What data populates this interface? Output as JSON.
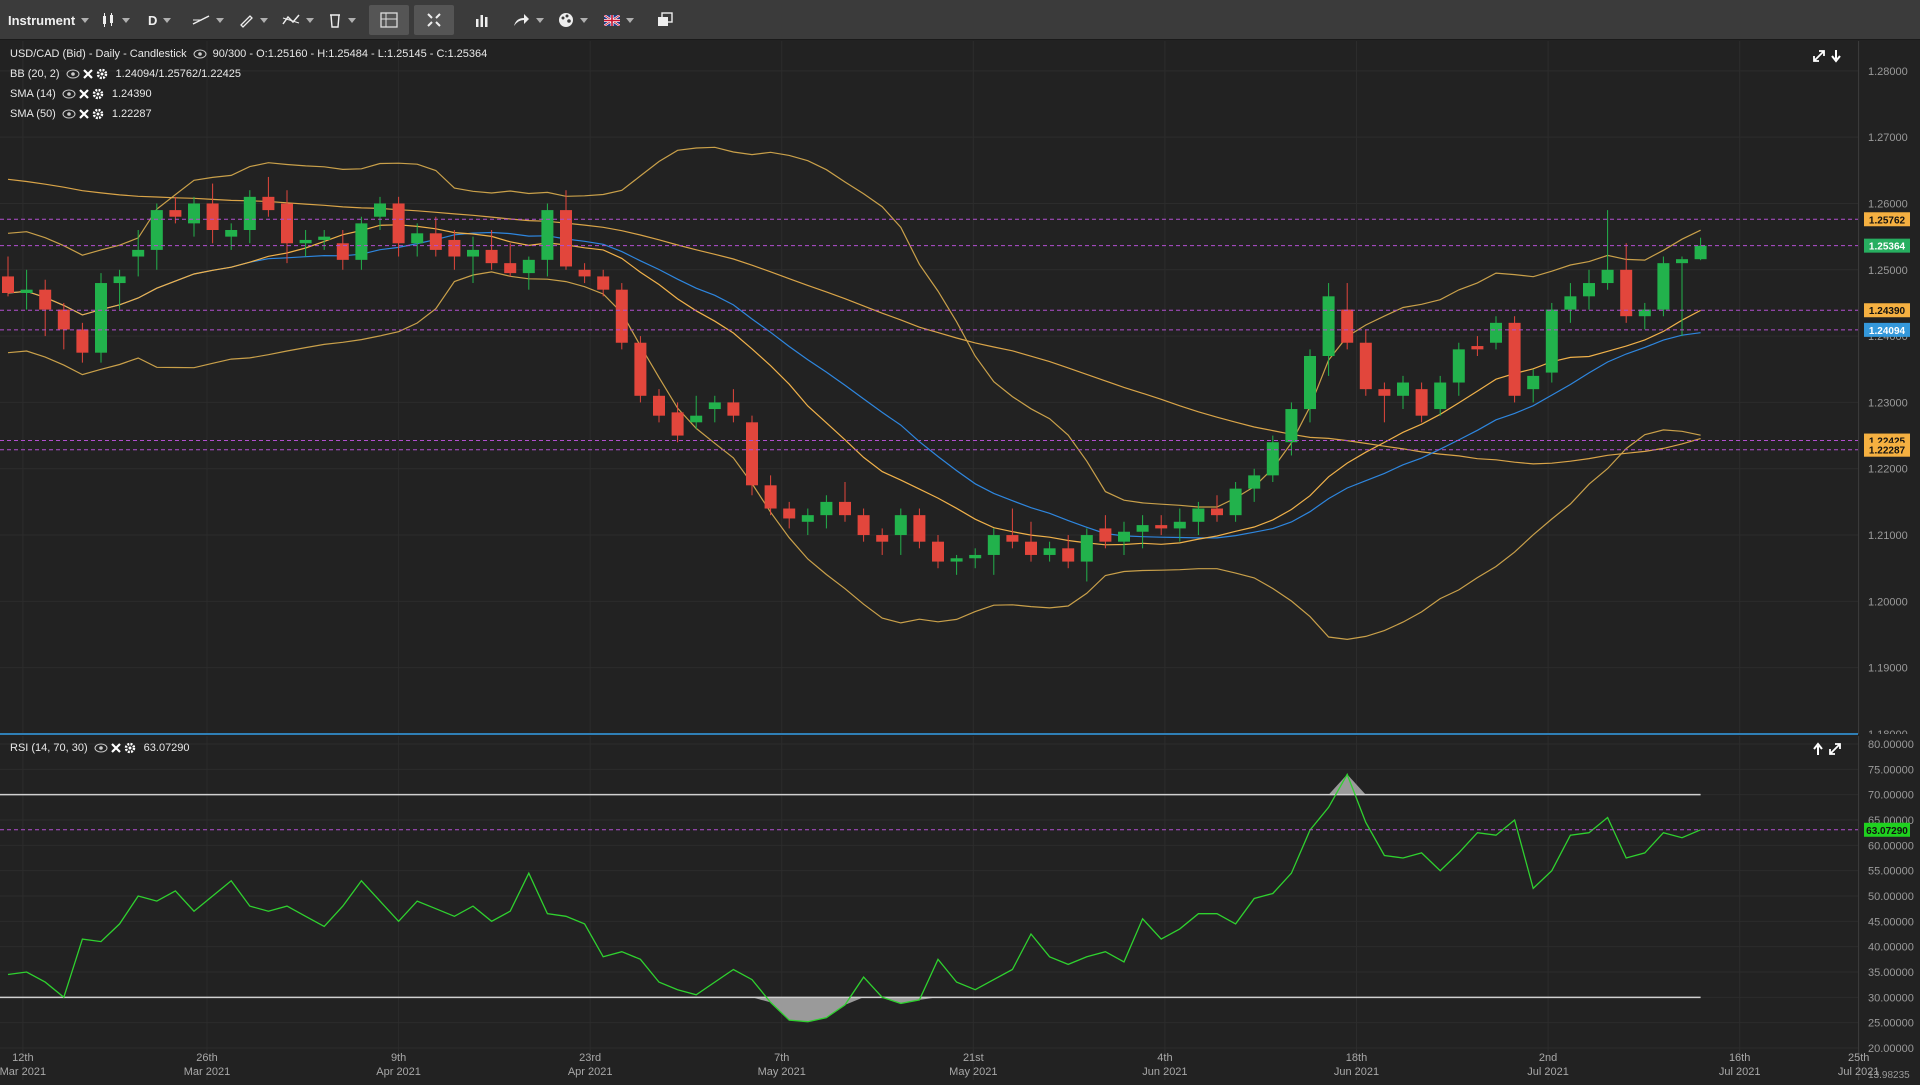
{
  "toolbar": {
    "instrument_label": "Instrument",
    "timeframe_label": "D"
  },
  "main_chart": {
    "header": "USD/CAD (Bid) - Daily - Candlestick",
    "ohlc": "90/300 - O:1.25160 - H:1.25484 - L:1.25145 - C:1.25364",
    "indicators": [
      {
        "name": "BB (20, 2)",
        "value": "1.24094/1.25762/1.22425"
      },
      {
        "name": "SMA (14)",
        "value": "1.24390"
      },
      {
        "name": "SMA (50)",
        "value": "1.22287"
      }
    ],
    "y_ticks": [
      "1.28000",
      "1.27000",
      "1.26000",
      "1.25000",
      "1.24000",
      "1.23000",
      "1.22000",
      "1.21000",
      "1.20000",
      "1.19000",
      "1.18000"
    ],
    "price_tags": [
      {
        "label": "1.25762",
        "value": 1.25762,
        "color": "#f5b041"
      },
      {
        "label": "1.25364",
        "value": 1.25364,
        "color": "#27ae60"
      },
      {
        "label": "1.24390",
        "value": 1.2439,
        "color": "#f5b041"
      },
      {
        "label": "1.24094",
        "value": 1.24094,
        "color": "#3498db"
      },
      {
        "label": "1.22425",
        "value": 1.22425,
        "color": "#f5b041"
      },
      {
        "label": "1.22287",
        "value": 1.22287,
        "color": "#f5b041"
      }
    ]
  },
  "rsi_chart": {
    "header": "RSI (14, 70, 30)",
    "value": "63.07290",
    "y_ticks": [
      "80.00000",
      "75.00000",
      "70.00000",
      "65.00000",
      "60.00000",
      "55.00000",
      "50.00000",
      "45.00000",
      "40.00000",
      "35.00000",
      "30.00000",
      "25.00000",
      "20.00000"
    ],
    "bottom_tick": "13.98235",
    "level_tag": {
      "label": "63.07290",
      "value": 63.0729,
      "color": "#1fd11f"
    }
  },
  "x_axis": [
    {
      "day": "12th",
      "month": "Mar 2021"
    },
    {
      "day": "26th",
      "month": "Mar 2021"
    },
    {
      "day": "9th",
      "month": "Apr 2021"
    },
    {
      "day": "23rd",
      "month": "Apr 2021"
    },
    {
      "day": "7th",
      "month": "May 2021"
    },
    {
      "day": "21st",
      "month": "May 2021"
    },
    {
      "day": "4th",
      "month": "Jun 2021"
    },
    {
      "day": "18th",
      "month": "Jun 2021"
    },
    {
      "day": "2nd",
      "month": "Jul 2021"
    },
    {
      "day": "16th",
      "month": "Jul 2021"
    },
    {
      "day": "25th",
      "month": "Jul 2021"
    }
  ],
  "chart_data": {
    "type": "candlestick",
    "instrument": "USD/CAD (Bid)",
    "timeframe": "Daily",
    "ylim": [
      1.18,
      1.2845
    ],
    "candles": [
      [
        1.249,
        1.252,
        1.246,
        1.2465
      ],
      [
        1.2465,
        1.25,
        1.244,
        1.247
      ],
      [
        1.247,
        1.2485,
        1.24,
        1.244
      ],
      [
        1.244,
        1.245,
        1.238,
        1.241
      ],
      [
        1.241,
        1.242,
        1.236,
        1.2375
      ],
      [
        1.2375,
        1.2495,
        1.236,
        1.248
      ],
      [
        1.248,
        1.25,
        1.244,
        1.249
      ],
      [
        1.252,
        1.256,
        1.249,
        1.253
      ],
      [
        1.253,
        1.26,
        1.25,
        1.259
      ],
      [
        1.259,
        1.261,
        1.257,
        1.258
      ],
      [
        1.257,
        1.261,
        1.255,
        1.26
      ],
      [
        1.26,
        1.263,
        1.254,
        1.256
      ],
      [
        1.255,
        1.257,
        1.253,
        1.256
      ],
      [
        1.256,
        1.262,
        1.254,
        1.261
      ],
      [
        1.261,
        1.264,
        1.258,
        1.259
      ],
      [
        1.26,
        1.262,
        1.251,
        1.254
      ],
      [
        1.254,
        1.256,
        1.252,
        1.2545
      ],
      [
        1.2545,
        1.256,
        1.253,
        1.255
      ],
      [
        1.254,
        1.256,
        1.25,
        1.2515
      ],
      [
        1.2515,
        1.258,
        1.25,
        1.257
      ],
      [
        1.258,
        1.261,
        1.256,
        1.26
      ],
      [
        1.26,
        1.261,
        1.252,
        1.254
      ],
      [
        1.254,
        1.257,
        1.252,
        1.2555
      ],
      [
        1.2555,
        1.258,
        1.252,
        1.253
      ],
      [
        1.2545,
        1.256,
        1.25,
        1.252
      ],
      [
        1.252,
        1.255,
        1.248,
        1.253
      ],
      [
        1.253,
        1.256,
        1.25,
        1.251
      ],
      [
        1.251,
        1.254,
        1.249,
        1.2495
      ],
      [
        1.2495,
        1.252,
        1.247,
        1.2515
      ],
      [
        1.2515,
        1.26,
        1.249,
        1.259
      ],
      [
        1.259,
        1.262,
        1.25,
        1.2505
      ],
      [
        1.25,
        1.251,
        1.248,
        1.249
      ],
      [
        1.249,
        1.25,
        1.246,
        1.247
      ],
      [
        1.247,
        1.248,
        1.238,
        1.239
      ],
      [
        1.239,
        1.24,
        1.23,
        1.231
      ],
      [
        1.231,
        1.232,
        1.227,
        1.228
      ],
      [
        1.2285,
        1.23,
        1.224,
        1.225
      ],
      [
        1.227,
        1.231,
        1.226,
        1.228
      ],
      [
        1.229,
        1.231,
        1.227,
        1.23
      ],
      [
        1.23,
        1.232,
        1.227,
        1.228
      ],
      [
        1.227,
        1.228,
        1.216,
        1.2175
      ],
      [
        1.2175,
        1.219,
        1.213,
        1.214
      ],
      [
        1.214,
        1.215,
        1.211,
        1.2125
      ],
      [
        1.212,
        1.214,
        1.21,
        1.213
      ],
      [
        1.213,
        1.216,
        1.211,
        1.215
      ],
      [
        1.215,
        1.218,
        1.212,
        1.213
      ],
      [
        1.213,
        1.214,
        1.209,
        1.21
      ],
      [
        1.21,
        1.211,
        1.207,
        1.209
      ],
      [
        1.21,
        1.214,
        1.207,
        1.213
      ],
      [
        1.213,
        1.214,
        1.208,
        1.209
      ],
      [
        1.209,
        1.21,
        1.205,
        1.206
      ],
      [
        1.206,
        1.207,
        1.204,
        1.2065
      ],
      [
        1.2065,
        1.208,
        1.205,
        1.207
      ],
      [
        1.207,
        1.211,
        1.204,
        1.21
      ],
      [
        1.21,
        1.214,
        1.208,
        1.209
      ],
      [
        1.209,
        1.212,
        1.206,
        1.207
      ],
      [
        1.207,
        1.209,
        1.206,
        1.208
      ],
      [
        1.208,
        1.21,
        1.205,
        1.206
      ],
      [
        1.206,
        1.211,
        1.203,
        1.21
      ],
      [
        1.211,
        1.213,
        1.208,
        1.209
      ],
      [
        1.209,
        1.212,
        1.207,
        1.2105
      ],
      [
        1.2105,
        1.213,
        1.208,
        1.2115
      ],
      [
        1.2115,
        1.213,
        1.21,
        1.211
      ],
      [
        1.211,
        1.214,
        1.209,
        1.212
      ],
      [
        1.212,
        1.215,
        1.21,
        1.214
      ],
      [
        1.214,
        1.216,
        1.212,
        1.213
      ],
      [
        1.213,
        1.218,
        1.212,
        1.217
      ],
      [
        1.217,
        1.22,
        1.215,
        1.219
      ],
      [
        1.219,
        1.225,
        1.218,
        1.224
      ],
      [
        1.224,
        1.23,
        1.222,
        1.229
      ],
      [
        1.229,
        1.238,
        1.227,
        1.237
      ],
      [
        1.237,
        1.248,
        1.234,
        1.246
      ],
      [
        1.244,
        1.248,
        1.238,
        1.239
      ],
      [
        1.239,
        1.241,
        1.231,
        1.232
      ],
      [
        1.232,
        1.233,
        1.227,
        1.231
      ],
      [
        1.231,
        1.234,
        1.229,
        1.233
      ],
      [
        1.232,
        1.233,
        1.227,
        1.228
      ],
      [
        1.229,
        1.234,
        1.228,
        1.233
      ],
      [
        1.233,
        1.239,
        1.231,
        1.238
      ],
      [
        1.2385,
        1.24,
        1.237,
        1.238
      ],
      [
        1.239,
        1.243,
        1.238,
        1.242
      ],
      [
        1.242,
        1.243,
        1.23,
        1.231
      ],
      [
        1.232,
        1.235,
        1.23,
        1.234
      ],
      [
        1.2345,
        1.245,
        1.233,
        1.244
      ],
      [
        1.244,
        1.248,
        1.242,
        1.246
      ],
      [
        1.246,
        1.25,
        1.244,
        1.248
      ],
      [
        1.248,
        1.259,
        1.247,
        1.25
      ],
      [
        1.25,
        1.254,
        1.242,
        1.243
      ],
      [
        1.243,
        1.245,
        1.241,
        1.244
      ],
      [
        1.244,
        1.252,
        1.243,
        1.251
      ],
      [
        1.251,
        1.252,
        1.24,
        1.2516
      ],
      [
        1.2516,
        1.25484,
        1.25145,
        1.25364
      ]
    ],
    "rsi": {
      "ylim": [
        20,
        80
      ],
      "overbought": 70,
      "oversold": 30,
      "values": [
        34.5,
        35,
        33,
        30,
        41.5,
        41,
        44.5,
        50,
        49,
        51,
        47,
        50,
        53,
        48,
        47,
        48,
        46,
        44,
        48,
        53,
        49,
        45,
        49,
        47.5,
        46,
        48,
        45,
        47,
        54.5,
        46.5,
        46,
        44.5,
        38,
        39,
        37.5,
        33,
        31.5,
        30.5,
        33,
        35.5,
        33.5,
        29,
        25.5,
        25.2,
        26,
        28.5,
        34,
        30,
        28.8,
        29.5,
        37.5,
        33,
        31.5,
        33.5,
        35.5,
        42.5,
        38,
        36.5,
        38,
        39,
        37,
        45.5,
        41.5,
        43.5,
        46.5,
        46.5,
        44.5,
        49.5,
        50.5,
        54.5,
        63,
        67.5,
        74,
        64.5,
        58,
        57.5,
        58.5,
        55,
        58.5,
        62.5,
        62,
        65,
        51.5,
        55,
        62,
        62.5,
        65.5,
        57.5,
        58.5,
        62.5,
        61.5,
        63.07
      ]
    },
    "series": [
      {
        "name": "BB (20, 2)"
      },
      {
        "name": "SMA (14)"
      },
      {
        "name": "SMA (50)"
      }
    ]
  }
}
